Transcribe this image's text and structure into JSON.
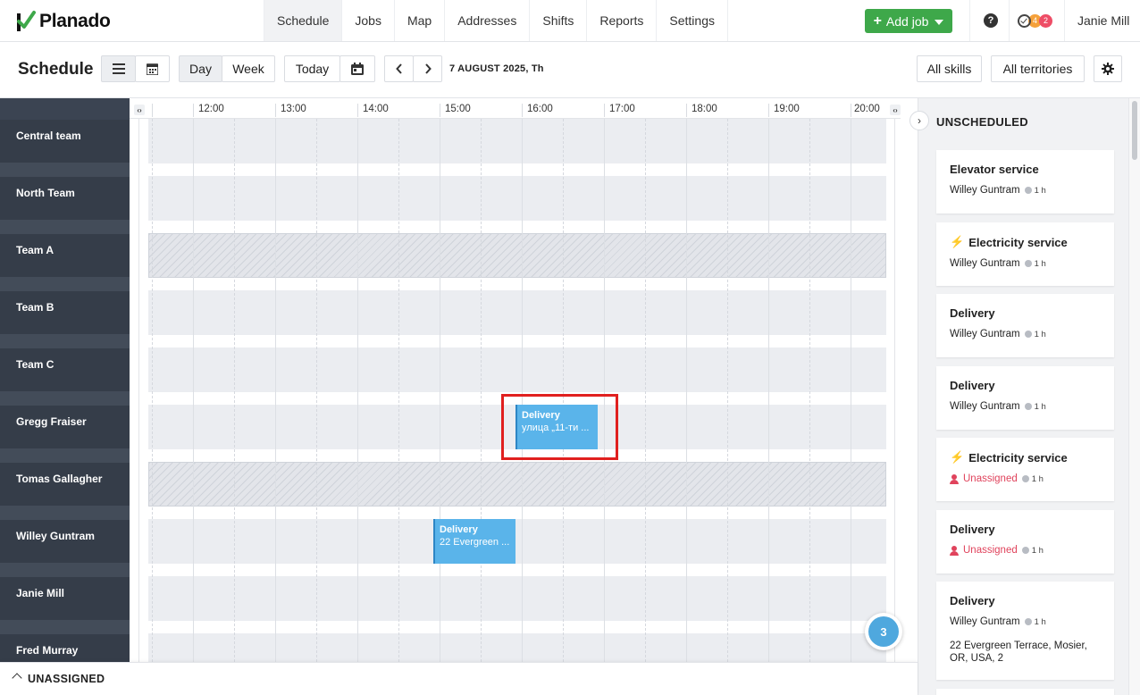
{
  "app": {
    "name": "Planado",
    "brand_color": "#3ea84a"
  },
  "nav": {
    "tabs": [
      "Schedule",
      "Jobs",
      "Map",
      "Addresses",
      "Shifts",
      "Reports",
      "Settings"
    ],
    "active_tab": "Schedule",
    "add_job_label": "Add job",
    "help_label": "?",
    "notifications": {
      "orange_count": "4",
      "red_count": "2"
    },
    "user_name": "Janie Mill"
  },
  "toolbar": {
    "title": "Schedule",
    "view_day": "Day",
    "view_week": "Week",
    "today": "Today",
    "date": "7 AUGUST 2025, Th",
    "all_skills": "All skills",
    "all_territories": "All territories"
  },
  "timeline": {
    "hours": [
      "12:00",
      "13:00",
      "14:00",
      "15:00",
      "16:00",
      "17:00",
      "18:00",
      "19:00",
      "20:00"
    ],
    "teams": [
      "Central team",
      "North Team",
      "Team A",
      "Team B",
      "Team C",
      "Gregg Fraiser",
      "Tomas Gallagher",
      "Willey Guntram",
      "Janie Mill",
      "Fred Murray"
    ],
    "jobs": [
      {
        "title": "Delivery",
        "address": "улица „11-ти ..."
      },
      {
        "title": "Delivery",
        "address": "22 Evergreen ..."
      }
    ],
    "job_count": "3"
  },
  "unscheduled": {
    "title": "UNSCHEDULED",
    "cards": [
      {
        "title": "Elevator service",
        "assignee": "Willey Guntram",
        "duration": "1 h"
      },
      {
        "title": "Electricity service",
        "assignee": "Willey Guntram",
        "duration": "1 h"
      },
      {
        "title": "Delivery",
        "assignee": "Willey Guntram",
        "duration": "1 h"
      },
      {
        "title": "Delivery",
        "assignee": "Willey Guntram",
        "duration": "1 h"
      },
      {
        "title": "Electricity service",
        "assignee": "Unassigned",
        "duration": "1 h"
      },
      {
        "title": "Delivery",
        "assignee": "Unassigned",
        "duration": "1 h"
      },
      {
        "title": "Delivery",
        "assignee": "Willey Guntram",
        "duration": "1 h",
        "address": "22 Evergreen Terrace, Mosier, OR, USA, 2"
      }
    ]
  },
  "bottom_bar": {
    "label": "UNASSIGNED"
  },
  "icons": {
    "lightning": "⚡",
    "chevron_right": "›"
  }
}
